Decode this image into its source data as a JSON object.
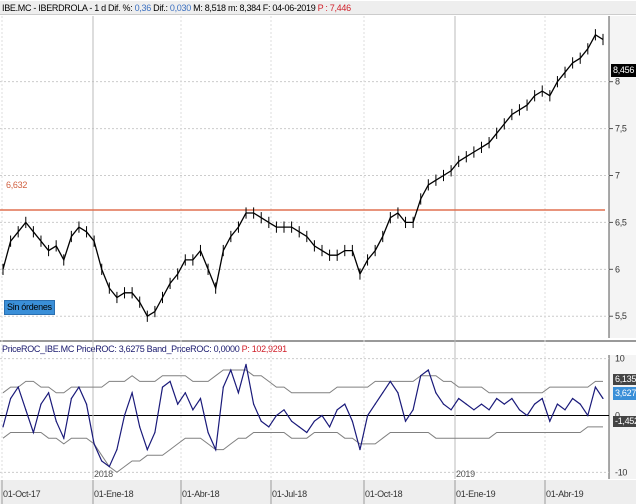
{
  "header": {
    "symbol": "IBE.MC - IBERDROLA - 1 d",
    "pct_label": "Dif. %:",
    "pct": "0,36",
    "dif_label": "Dif.:",
    "dif": "0,030",
    "max": "M: 8,518",
    "min": "m: 8,384",
    "date": "F: 04-06-2019",
    "p": "P : 7,446"
  },
  "indicator_header": {
    "name": "PriceROC_IBE.MC",
    "roc": "PriceROC: 3,6275",
    "band": "Band_PriceROC: 0,0000",
    "p": "P: 102,9291"
  },
  "orders_button": "Sin órdenes",
  "colors": {
    "price": "#000000",
    "level": "#e07050",
    "roc": "#1a1a7a",
    "band": "#808080"
  },
  "chart_data": [
    {
      "type": "line",
      "title": "IBE.MC - IBERDROLA",
      "ylim": [
        5.3,
        8.7
      ],
      "yticks": [
        "8",
        "7,5",
        "7",
        "6,5",
        "6",
        "5,5"
      ],
      "ytick_values": [
        8,
        7.5,
        7,
        6.5,
        6,
        5.5
      ],
      "last_label": "8,456",
      "hline": {
        "value": 6.632,
        "label": "6,632"
      },
      "values": [
        6.0,
        6.3,
        6.4,
        6.5,
        6.4,
        6.3,
        6.2,
        6.25,
        6.1,
        6.35,
        6.45,
        6.4,
        6.3,
        6.0,
        5.8,
        5.7,
        5.75,
        5.75,
        5.65,
        5.5,
        5.55,
        5.7,
        5.85,
        5.95,
        6.1,
        6.1,
        6.2,
        6.0,
        5.8,
        6.2,
        6.35,
        6.45,
        6.6,
        6.6,
        6.55,
        6.5,
        6.45,
        6.45,
        6.45,
        6.4,
        6.35,
        6.25,
        6.2,
        6.15,
        6.15,
        6.2,
        6.2,
        5.95,
        6.1,
        6.2,
        6.35,
        6.55,
        6.6,
        6.5,
        6.5,
        6.75,
        6.9,
        6.95,
        7.0,
        7.05,
        7.15,
        7.2,
        7.25,
        7.3,
        7.35,
        7.45,
        7.55,
        7.65,
        7.7,
        7.75,
        7.85,
        7.9,
        7.85,
        8.0,
        8.1,
        8.2,
        8.25,
        8.35,
        8.5,
        8.45
      ]
    },
    {
      "type": "line",
      "title": "PriceROC",
      "ylim": [
        -11,
        11
      ],
      "yticks": [
        "10",
        "0",
        "-10"
      ],
      "ytick_values": [
        10,
        0,
        -10
      ],
      "labels": {
        "upper": "6,135",
        "value": "3,627",
        "lower": "-1,452"
      },
      "roc": [
        -2,
        3,
        5,
        1,
        -3,
        2,
        4,
        -1,
        -4,
        3,
        5,
        2,
        -5,
        -8,
        -9,
        -6,
        0,
        4,
        -2,
        -6,
        -3,
        5,
        6,
        2,
        4,
        1,
        3,
        -3,
        -6,
        5,
        8,
        4,
        9,
        2,
        -1,
        -2,
        0,
        1,
        -1,
        -2,
        -3,
        -1,
        0,
        -2,
        1,
        2,
        -1,
        -6,
        0,
        2,
        4,
        6,
        4,
        -1,
        1,
        7,
        8,
        4,
        2,
        1,
        3,
        2,
        1,
        2,
        1,
        3,
        2,
        3,
        1,
        0,
        2,
        3,
        -1,
        2,
        1,
        3,
        2,
        0,
        5,
        3
      ],
      "upper": [
        4,
        5,
        5,
        6,
        6,
        5,
        5,
        4,
        4,
        5,
        5,
        5,
        5,
        5,
        6,
        6,
        6,
        7,
        6,
        6,
        6,
        7,
        7,
        7,
        7,
        6,
        6,
        6,
        7,
        8,
        8,
        8,
        8,
        7,
        7,
        6,
        5,
        5,
        4,
        4,
        4,
        4,
        4,
        4,
        5,
        5,
        5,
        5,
        5,
        6,
        6,
        6,
        6,
        6,
        6,
        7,
        7,
        7,
        6,
        6,
        5,
        5,
        5,
        5,
        4,
        4,
        4,
        4,
        4,
        4,
        4,
        4,
        5,
        5,
        5,
        5,
        5,
        5,
        6,
        6
      ],
      "lower": [
        -4,
        -3,
        -3,
        -3,
        -3,
        -3,
        -4,
        -4,
        -5,
        -4,
        -4,
        -4,
        -5,
        -7,
        -9,
        -10,
        -9,
        -8,
        -8,
        -7,
        -7,
        -7,
        -6,
        -5,
        -4,
        -4,
        -4,
        -5,
        -6,
        -6,
        -5,
        -4,
        -4,
        -3,
        -3,
        -3,
        -3,
        -3,
        -4,
        -4,
        -4,
        -3,
        -3,
        -3,
        -3,
        -4,
        -4,
        -5,
        -5,
        -5,
        -4,
        -3,
        -3,
        -3,
        -3,
        -3,
        -3,
        -4,
        -4,
        -4,
        -4,
        -4,
        -4,
        -4,
        -4,
        -3,
        -3,
        -3,
        -3,
        -3,
        -3,
        -3,
        -3,
        -3,
        -3,
        -3,
        -3,
        -2,
        -2,
        -2
      ]
    }
  ],
  "x_axis": {
    "dates": [
      "01-Oct-17",
      "01-Ene-18",
      "01-Abr-18",
      "01-Jul-18",
      "01-Oct-18",
      "01-Ene-19",
      "01-Abr-19"
    ],
    "years": [
      "2018",
      "2019"
    ]
  }
}
